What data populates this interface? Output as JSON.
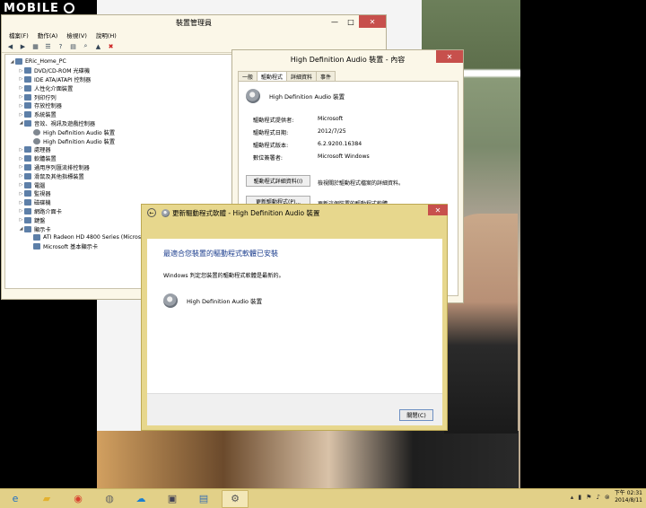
{
  "watermark": {
    "text": "MOBILE"
  },
  "device_manager": {
    "title": "裝置管理員",
    "menu": [
      "檔案(F)",
      "動作(A)",
      "檢視(V)",
      "說明(H)"
    ],
    "tree": [
      {
        "arrow": "◢",
        "label": "ERic_Home_PC",
        "indent": 0,
        "icon": "computer-icon"
      },
      {
        "arrow": "▷",
        "label": "DVD/CD-ROM 光碟機",
        "indent": 1,
        "icon": "dvd-icon"
      },
      {
        "arrow": "▷",
        "label": "IDE ATA/ATAPI 控制器",
        "indent": 1,
        "icon": "ide-icon"
      },
      {
        "arrow": "▷",
        "label": "人性化介面裝置",
        "indent": 1,
        "icon": "hid-icon"
      },
      {
        "arrow": "▷",
        "label": "列印佇列",
        "indent": 1,
        "icon": "printer-icon"
      },
      {
        "arrow": "▷",
        "label": "存放控制器",
        "indent": 1,
        "icon": "storage-icon"
      },
      {
        "arrow": "▷",
        "label": "系統裝置",
        "indent": 1,
        "icon": "system-icon"
      },
      {
        "arrow": "◢",
        "label": "音效、視訊及遊戲控制器",
        "indent": 1,
        "icon": "audio-icon"
      },
      {
        "arrow": "",
        "label": "High Definition Audio 裝置",
        "indent": 2,
        "icon": "speaker-icon"
      },
      {
        "arrow": "",
        "label": "High Definition Audio 裝置",
        "indent": 2,
        "icon": "speaker-icon"
      },
      {
        "arrow": "▷",
        "label": "處理器",
        "indent": 1,
        "icon": "cpu-icon"
      },
      {
        "arrow": "▷",
        "label": "軟體裝置",
        "indent": 1,
        "icon": "software-icon"
      },
      {
        "arrow": "▷",
        "label": "通用序列匯流排控制器",
        "indent": 1,
        "icon": "usb-icon"
      },
      {
        "arrow": "▷",
        "label": "滑鼠及其他指標裝置",
        "indent": 1,
        "icon": "mouse-icon"
      },
      {
        "arrow": "▷",
        "label": "電腦",
        "indent": 1,
        "icon": "computer-icon"
      },
      {
        "arrow": "▷",
        "label": "監視器",
        "indent": 1,
        "icon": "monitor-icon"
      },
      {
        "arrow": "▷",
        "label": "磁碟機",
        "indent": 1,
        "icon": "disk-icon"
      },
      {
        "arrow": "▷",
        "label": "網路介面卡",
        "indent": 1,
        "icon": "network-icon"
      },
      {
        "arrow": "▷",
        "label": "鍵盤",
        "indent": 1,
        "icon": "keyboard-icon"
      },
      {
        "arrow": "◢",
        "label": "顯示卡",
        "indent": 1,
        "icon": "display-icon"
      },
      {
        "arrow": "",
        "label": "ATI Radeon HD 4800 Series (Micros",
        "indent": 2,
        "icon": "display-icon"
      },
      {
        "arrow": "",
        "label": "Microsoft 基本顯示卡",
        "indent": 2,
        "icon": "display-icon"
      }
    ]
  },
  "properties": {
    "title": "High Definition Audio 裝置 - 內容",
    "tabs": [
      "一般",
      "驅動程式",
      "詳細資料",
      "事件"
    ],
    "active_tab": 1,
    "device_name": "High Definition Audio 裝置",
    "fields": [
      {
        "key": "驅動程式提供者:",
        "value": "Microsoft"
      },
      {
        "key": "驅動程式日期:",
        "value": "2012/7/25"
      },
      {
        "key": "驅動程式版本:",
        "value": "6.2.9200.16384"
      },
      {
        "key": "數位簽署者:",
        "value": "Microsoft Windows"
      }
    ],
    "buttons": [
      {
        "label": "驅動程式詳細資料(I)",
        "desc": "檢視關於驅動程式檔案的詳細資料。"
      },
      {
        "label": "更新驅動程式(P)...",
        "desc": "更新這個裝置的驅動程式軟體。"
      }
    ]
  },
  "wizard": {
    "title": "更新驅動程式軟體 - High Definition Audio 裝置",
    "heading": "最適合您裝置的驅動程式軟體已安裝",
    "text": "Windows 判定您裝置的驅動程式軟體是最新的。",
    "device": "High Definition Audio 裝置",
    "close_label": "關閉(C)"
  },
  "taskbar": {
    "apps": [
      {
        "name": "ie-icon",
        "glyph": "e",
        "color": "#1f6fc4"
      },
      {
        "name": "explorer-icon",
        "glyph": "▰",
        "color": "#e3b12f"
      },
      {
        "name": "chrome-icon",
        "glyph": "◉",
        "color": "#d8412f"
      },
      {
        "name": "app-icon",
        "glyph": "◍",
        "color": "#666"
      },
      {
        "name": "cloud-icon",
        "glyph": "☁",
        "color": "#1a7fd0"
      },
      {
        "name": "window-icon",
        "glyph": "▣",
        "color": "#445"
      },
      {
        "name": "desktop-icon",
        "glyph": "▤",
        "color": "#3a6fb0"
      },
      {
        "name": "devmgr-icon",
        "glyph": "⚙",
        "color": "#555"
      }
    ],
    "time": "下午 02:31",
    "date": "2014/8/11"
  }
}
